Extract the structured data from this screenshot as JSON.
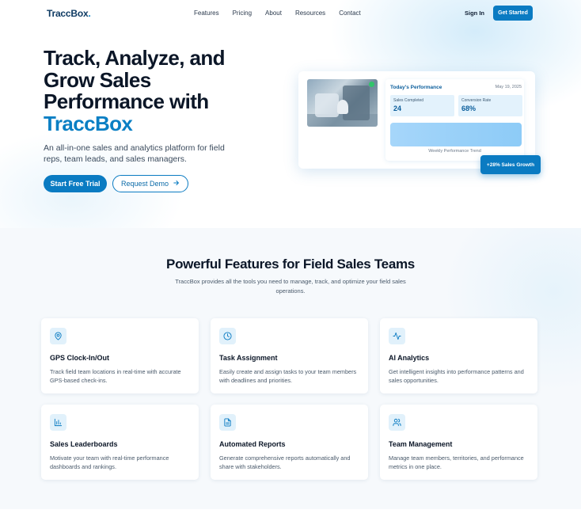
{
  "nav": {
    "logo": "TraccBox",
    "logo_dot": ".",
    "links": [
      "Features",
      "Pricing",
      "About",
      "Resources",
      "Contact"
    ],
    "sign_in": "Sign In",
    "get_started": "Get Started"
  },
  "hero": {
    "title": "Track, Analyze, and Grow Sales Performance with",
    "title_brand": "TraccBox",
    "subtitle": "An all-in-one sales and analytics platform for field reps, team leads, and sales managers.",
    "primary_cta": "Start Free Trial",
    "secondary_cta": "Request Demo",
    "secondary_cta_icon": "arrow-right-icon"
  },
  "dashboard": {
    "title": "Today's Performance",
    "date": "May 19, 2025",
    "stats": [
      {
        "label": "Sales Completed",
        "value": "24"
      },
      {
        "label": "Conversion Rate",
        "value": "68%"
      }
    ],
    "trend_label": "Weekly Performance Trend",
    "growth_badge": "+28% Sales Growth",
    "colors": {
      "accent": "#0a7bc2",
      "panel": "#e3f2fc"
    }
  },
  "features": {
    "title": "Powerful Features for Field Sales Teams",
    "subtitle": "TraccBox provides all the tools you need to manage, track, and optimize your field sales operations.",
    "items": [
      {
        "icon": "map-pin-icon",
        "title": "GPS Clock-In/Out",
        "desc": "Track field team locations in real-time with accurate GPS-based check-ins."
      },
      {
        "icon": "clock-icon",
        "title": "Task Assignment",
        "desc": "Easily create and assign tasks to your team members with deadlines and priorities."
      },
      {
        "icon": "activity-icon",
        "title": "AI Analytics",
        "desc": "Get intelligent insights into performance patterns and sales opportunities."
      },
      {
        "icon": "bar-chart-icon",
        "title": "Sales Leaderboards",
        "desc": "Motivate your team with real-time performance dashboards and rankings."
      },
      {
        "icon": "file-text-icon",
        "title": "Automated Reports",
        "desc": "Generate comprehensive reports automatically and share with stakeholders."
      },
      {
        "icon": "users-icon",
        "title": "Team Management",
        "desc": "Manage team members, territories, and performance metrics in one place."
      }
    ]
  }
}
